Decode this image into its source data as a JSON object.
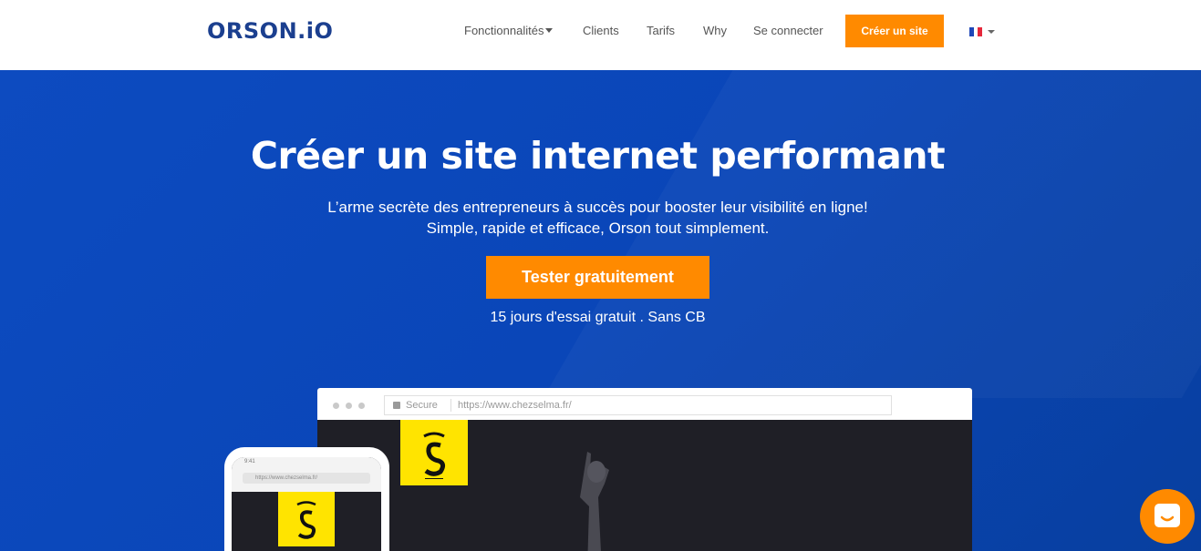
{
  "header": {
    "logo": "ORSON.iO",
    "nav": {
      "features": "Fonctionnalités",
      "clients": "Clients",
      "pricing": "Tarifs",
      "why": "Why",
      "login": "Se connecter"
    },
    "cta": "Créer un site",
    "language": "fr"
  },
  "hero": {
    "title": "Créer un site internet performant",
    "subtitle_line1": "L’arme secrète des entrepreneurs à succès pour booster leur visibilité en ligne!",
    "subtitle_line2": "Simple, rapide et efficace, Orson tout simplement.",
    "cta": "Tester gratuitement",
    "trial_note": "15 jours d'essai gratuit . Sans CB"
  },
  "mockup": {
    "secure_label": "Secure",
    "url": "https://www.chezselma.fr/",
    "phone_time": "9:41",
    "phone_url": "https://www.chezselma.fr/"
  },
  "colors": {
    "brand": "#1b3f8f",
    "accent": "#ff8a00",
    "hero_bg": "#0a46b8"
  },
  "icons": {
    "chat": "chat-bubble-icon",
    "language": "france-flag-icon"
  }
}
